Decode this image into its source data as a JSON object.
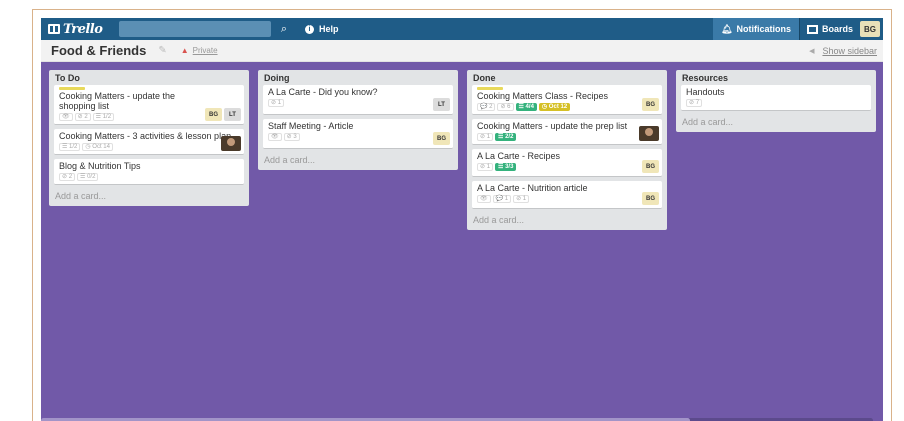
{
  "topbar": {
    "logo": "Trello",
    "help": "Help",
    "notifications": "Notifications",
    "boards": "Boards",
    "user_initials": "BG"
  },
  "board": {
    "title": "Food & Friends",
    "visibility": "Private",
    "show_sidebar": "Show sidebar",
    "background_color": "#7159a8"
  },
  "lists": [
    {
      "title": "To Do",
      "add_card": "Add a card...",
      "cards": [
        {
          "title": "Cooking Matters - update the shopping list",
          "badges": [
            "👁",
            "⊘ 2",
            "☰ 1/2"
          ],
          "members": [
            "BG",
            "LT"
          ]
        },
        {
          "title": "Cooking Matters - 3 activities & lesson plan",
          "badges": [
            "☰ 1/2",
            "◷ Oct 14"
          ],
          "members": [
            "photo"
          ]
        },
        {
          "title": "Blog & Nutrition Tips",
          "badges": [
            "⊘ 2",
            "☰ 0/2"
          ],
          "members": []
        }
      ]
    },
    {
      "title": "Doing",
      "add_card": "Add a card...",
      "cards": [
        {
          "title": "A La Carte - Did you know?",
          "badges": [
            "⊘ 1"
          ],
          "members": [
            "LT"
          ]
        },
        {
          "title": "Staff Meeting - Article",
          "badges": [
            "👁",
            "⊘ 3"
          ],
          "members": [
            "BG"
          ]
        }
      ]
    },
    {
      "title": "Done",
      "add_card": "Add a card...",
      "cards": [
        {
          "title": "Cooking Matters Class - Recipes",
          "badges": [
            "💬 2",
            "⊘ 6",
            "☰ 4/4",
            "◷ Oct 12"
          ],
          "members": [
            "BG"
          ]
        },
        {
          "title": "Cooking Matters - update the prep list",
          "badges": [
            "⊘ 1",
            "☰ 2/2"
          ],
          "members": [
            "photo"
          ]
        },
        {
          "title": "A La Carte - Recipes",
          "badges": [
            "⊘ 1",
            "☰ 3/3"
          ],
          "members": [
            "BG"
          ]
        },
        {
          "title": "A La Carte - Nutrition article",
          "badges": [
            "👁",
            "💬 1",
            "⊘ 1"
          ],
          "members": [
            "BG"
          ]
        }
      ]
    },
    {
      "title": "Resources",
      "add_card": "Add a card...",
      "cards": [
        {
          "title": "Handouts",
          "badges": [
            "⊘ 7"
          ],
          "members": []
        }
      ]
    }
  ]
}
